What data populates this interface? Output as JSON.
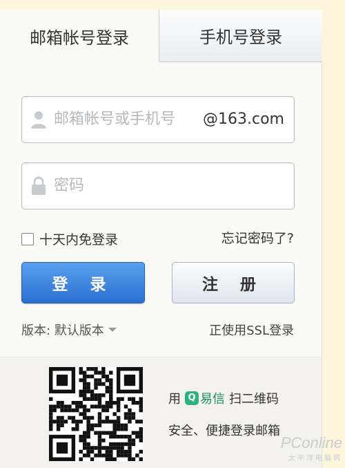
{
  "tabs": [
    {
      "label": "邮箱帐号登录",
      "active": true
    },
    {
      "label": "手机号登录",
      "active": false
    }
  ],
  "username": {
    "placeholder": "邮箱帐号或手机号",
    "suffix": "@163.com",
    "icon": "user-icon"
  },
  "password": {
    "placeholder": "密码",
    "icon": "lock-icon"
  },
  "remember": {
    "label": "十天内免登录",
    "checked": false
  },
  "forgot_label": "忘记密码了?",
  "buttons": {
    "login": "登 录",
    "register": "注 册"
  },
  "version": {
    "label": "版本: 默认版本"
  },
  "ssl_label": "正使用SSL登录",
  "qr": {
    "prefix": "用",
    "app_icon": "Q",
    "app_name": "易信",
    "suffix": "扫二维码",
    "subtitle": "安全、便捷登录邮箱"
  },
  "watermark": {
    "main": "PConline",
    "sub": "太平洋电脑网"
  },
  "colors": {
    "accent": "#2b6fd0",
    "background": "#fdf6dc",
    "yixin": "#2fb083"
  }
}
